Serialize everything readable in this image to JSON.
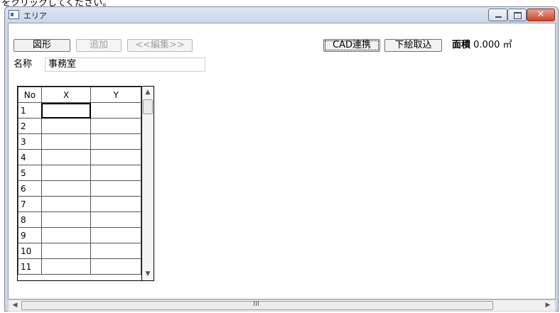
{
  "background_text": "をクリックしてください。",
  "window": {
    "title": "エリア",
    "close_glyph": "✕"
  },
  "toolbar": {
    "shape_button": "図形",
    "add_button": "追加",
    "edit_button": "<<編集>>",
    "cad_link_button": "CAD連携",
    "import_button": "下絵取込",
    "area_label": "面積",
    "area_value": "0.000 ㎡"
  },
  "name_field": {
    "label": "名称",
    "value": "事務室"
  },
  "grid": {
    "columns": [
      "No",
      "X",
      "Y"
    ],
    "rows": [
      {
        "no": "1",
        "x": "",
        "y": ""
      },
      {
        "no": "2",
        "x": "",
        "y": ""
      },
      {
        "no": "3",
        "x": "",
        "y": ""
      },
      {
        "no": "4",
        "x": "",
        "y": ""
      },
      {
        "no": "5",
        "x": "",
        "y": ""
      },
      {
        "no": "6",
        "x": "",
        "y": ""
      },
      {
        "no": "7",
        "x": "",
        "y": ""
      },
      {
        "no": "8",
        "x": "",
        "y": ""
      },
      {
        "no": "9",
        "x": "",
        "y": ""
      },
      {
        "no": "10",
        "x": "",
        "y": ""
      },
      {
        "no": "11",
        "x": "",
        "y": ""
      }
    ],
    "selected_cell": "row1-x"
  },
  "scrollbars": {
    "up": "▲",
    "down": "▼",
    "left": "◀",
    "right": "▶",
    "grip": "III"
  },
  "colors": {
    "window_frame": "#cdd9e8",
    "close_button": "#c9462c",
    "focus_outline": "#3c7fb1"
  }
}
